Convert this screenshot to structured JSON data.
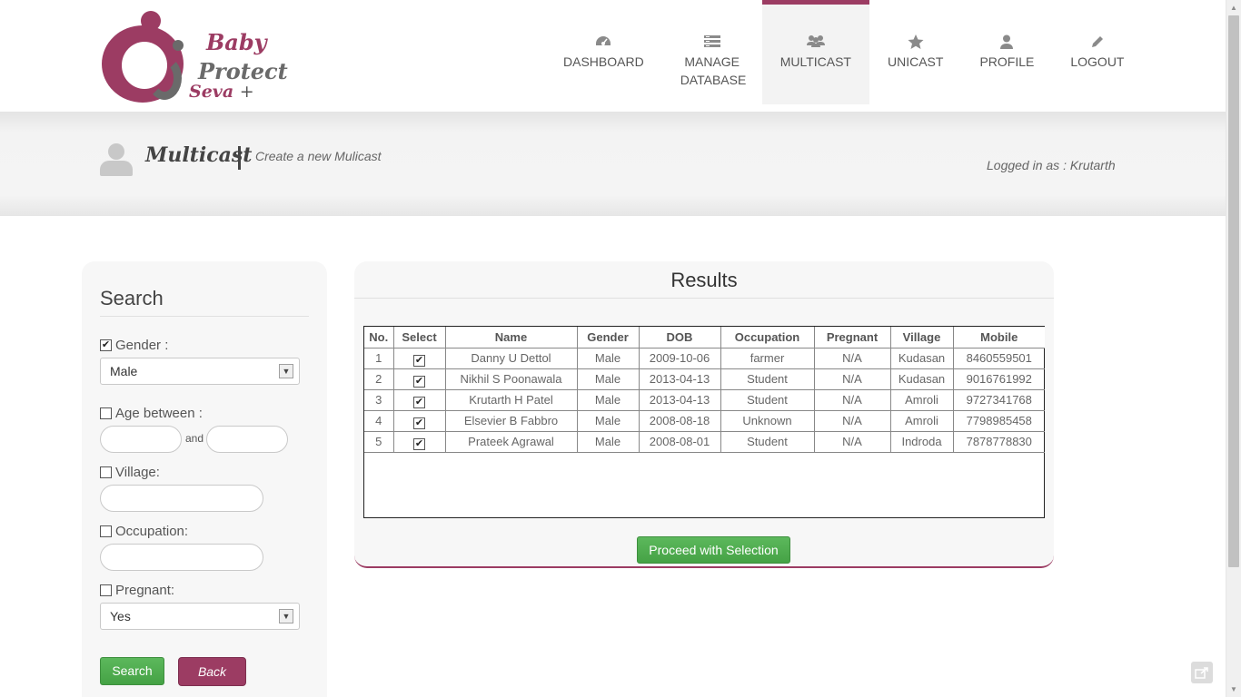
{
  "brand": {
    "line1": "Baby",
    "line2": "Protect",
    "line3": "Seva",
    "plus": "+"
  },
  "nav": {
    "items": [
      {
        "label": "DASHBOARD",
        "icon": "dashboard-icon"
      },
      {
        "label": "MANAGE DATABASE",
        "icon": "database-icon"
      },
      {
        "label": "MULTICAST",
        "icon": "group-icon",
        "active": true
      },
      {
        "label": "UNICAST",
        "icon": "star-icon"
      },
      {
        "label": "PROFILE",
        "icon": "user-icon"
      },
      {
        "label": "LOGOUT",
        "icon": "pencil-icon"
      }
    ]
  },
  "banner": {
    "title": "Multicast",
    "subtitle": "Create a new Mulicast",
    "logged_in": "Logged in as : Krutarth"
  },
  "search": {
    "heading": "Search",
    "gender_label": "Gender :",
    "gender_value": "Male",
    "age_label": "Age between :",
    "and_text": "and",
    "village_label": "Village:",
    "occupation_label": "Occupation:",
    "pregnant_label": "Pregnant:",
    "pregnant_value": "Yes",
    "search_button": "Search",
    "back_button": "Back"
  },
  "results": {
    "heading": "Results",
    "columns": [
      "No.",
      "Select",
      "Name",
      "Gender",
      "DOB",
      "Occupation",
      "Pregnant",
      "Village",
      "Mobile"
    ],
    "rows": [
      {
        "no": "1",
        "name": "Danny U Dettol",
        "gender": "Male",
        "dob": "2009-10-06",
        "occupation": "farmer",
        "pregnant": "N/A",
        "village": "Kudasan",
        "mobile": "8460559501"
      },
      {
        "no": "2",
        "name": "Nikhil S Poonawala",
        "gender": "Male",
        "dob": "2013-04-13",
        "occupation": "Student",
        "pregnant": "N/A",
        "village": "Kudasan",
        "mobile": "9016761992"
      },
      {
        "no": "3",
        "name": "Krutarth H Patel",
        "gender": "Male",
        "dob": "2013-04-13",
        "occupation": "Student",
        "pregnant": "N/A",
        "village": "Amroli",
        "mobile": "9727341768"
      },
      {
        "no": "4",
        "name": "Elsevier B Fabbro",
        "gender": "Male",
        "dob": "2008-08-18",
        "occupation": "Unknown",
        "pregnant": "N/A",
        "village": "Amroli",
        "mobile": "7798985458"
      },
      {
        "no": "5",
        "name": "Prateek Agrawal",
        "gender": "Male",
        "dob": "2008-08-01",
        "occupation": "Student",
        "pregnant": "N/A",
        "village": "Indroda",
        "mobile": "7878778830"
      }
    ],
    "proceed_button": "Proceed with Selection"
  },
  "colors": {
    "brand": "#9c3c63",
    "success": "#5cb85c"
  }
}
